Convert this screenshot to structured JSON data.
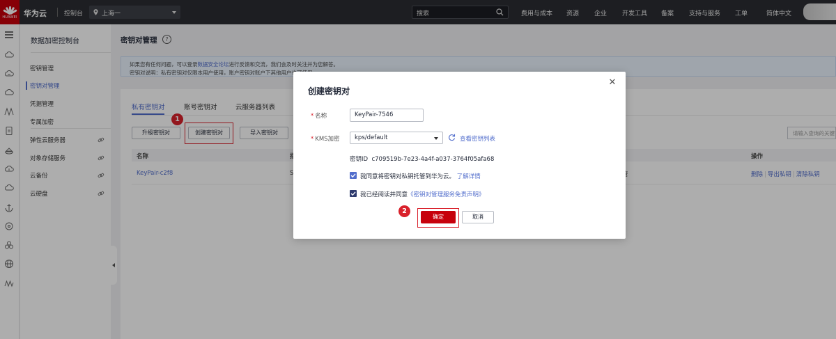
{
  "topbar": {
    "brand": "华为云",
    "console": "控制台",
    "region": "上海一",
    "search_placeholder": "搜索",
    "nav": [
      "费用与成本",
      "资源",
      "企业",
      "开发工具",
      "备案",
      "支持与服务",
      "工单",
      "简体中文"
    ]
  },
  "logo": {
    "word": "HUAWEI"
  },
  "sidebar": {
    "title": "数据加密控制台",
    "items": [
      "密钥管理",
      "密钥对管理",
      "凭据管理",
      "专属加密",
      "弹性云服务器",
      "对象存储服务",
      "云备份",
      "云硬盘"
    ],
    "active": "密钥对管理"
  },
  "page": {
    "title": "密钥对管理",
    "notice_line1_pre": "如果您有任何问题，可以登录",
    "notice_link": "数据安全论坛",
    "notice_line1_post": "进行反馈和交流，我们会及时关注并为您解答。",
    "notice_line2": "密钥对说明：私有密钥对仅限本用户使用，账户密钥对账户下其他用户也可使用。",
    "tabs": [
      "私有密钥对",
      "账号密钥对",
      "云服务器列表"
    ],
    "buttons": {
      "upgrade": "升级密钥对",
      "create": "创建密钥对",
      "import": "导入密钥对"
    },
    "search_placeholder": "请输入查询的关键字",
    "columns": {
      "name": "名称",
      "fingerprint": "指",
      "ops": "操作"
    },
    "row": {
      "name": "KeyPair-c2f8",
      "fingerprint": "S",
      "status": "管",
      "ops": [
        "删除",
        "导出私钥",
        "清除私钥"
      ]
    }
  },
  "modal": {
    "title": "创建密钥对",
    "name_label": "名称",
    "name_value": "KeyPair-7546",
    "kms_label": "KMS加密",
    "kms_value": "kps/default",
    "kms_link": "查看密钥列表",
    "key_id_label": "密钥ID",
    "key_id_value": "c709519b-7e23-4a4f-a037-3764f05afa68",
    "agree1_text": "我同意将密钥对私钥托管到华为云。",
    "agree1_link": "了解详情",
    "agree2_text": "我已经阅读并同意",
    "agree2_link": "《密钥对管理服务免责声明》",
    "confirm": "确定",
    "cancel": "取消"
  },
  "annotations": {
    "step1": "1",
    "step2": "2"
  },
  "colors": {
    "brand_red": "#c7000b",
    "primary_blue": "#526ecc",
    "confirm_red": "#c7000b",
    "checkbox_blue": "#526ecc",
    "checkbox_navy": "#2e3a6e"
  }
}
